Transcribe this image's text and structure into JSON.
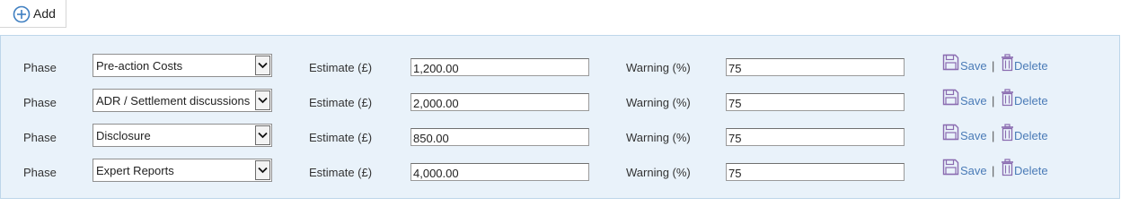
{
  "toolbar": {
    "add_label": "Add",
    "add_icon": "plus-circle-icon"
  },
  "colors": {
    "panel_bg": "#e9f2fa",
    "link": "#4a7bb7",
    "icon": "#8a6bb0"
  },
  "rows": [
    {
      "phase_label": "Phase",
      "phase_value": "Pre-action Costs",
      "estimate_label": "Estimate (£)",
      "estimate_value": "1,200.00",
      "warning_label": "Warning (%)",
      "warning_value": "75",
      "save_label": "Save",
      "separator": "|",
      "delete_label": "Delete"
    },
    {
      "phase_label": "Phase",
      "phase_value": "ADR / Settlement discussions",
      "estimate_label": "Estimate (£)",
      "estimate_value": "2,000.00",
      "warning_label": "Warning (%)",
      "warning_value": "75",
      "save_label": "Save",
      "separator": "|",
      "delete_label": "Delete"
    },
    {
      "phase_label": "Phase",
      "phase_value": "Disclosure",
      "estimate_label": "Estimate (£)",
      "estimate_value": "850.00",
      "warning_label": "Warning (%)",
      "warning_value": "75",
      "save_label": "Save",
      "separator": "|",
      "delete_label": "Delete"
    },
    {
      "phase_label": "Phase",
      "phase_value": "Expert Reports",
      "estimate_label": "Estimate (£)",
      "estimate_value": "4,000.00",
      "warning_label": "Warning (%)",
      "warning_value": "75",
      "save_label": "Save",
      "separator": "|",
      "delete_label": "Delete"
    }
  ]
}
